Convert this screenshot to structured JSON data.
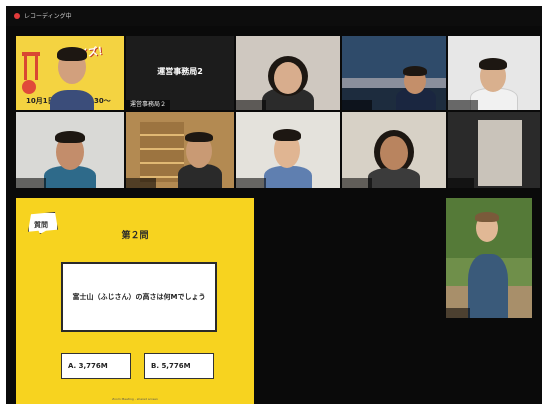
{
  "window": {
    "title": "レコーディング中"
  },
  "participants": [
    {
      "id": "p1",
      "name": ""
    },
    {
      "id": "p2",
      "name": "運営事務局2",
      "label": "運営事務局２"
    },
    {
      "id": "p3",
      "name": ""
    },
    {
      "id": "p4",
      "name": ""
    },
    {
      "id": "p5",
      "name": ""
    },
    {
      "id": "p6",
      "name": ""
    },
    {
      "id": "p7",
      "name": ""
    },
    {
      "id": "p8",
      "name": ""
    },
    {
      "id": "p9",
      "name": ""
    },
    {
      "id": "p10",
      "name": ""
    },
    {
      "id": "p11",
      "name": ""
    }
  ],
  "poster": {
    "title": "クイズ！",
    "date": "10月1日",
    "time": "30〜"
  },
  "slide": {
    "badge": "質問",
    "title": "第２問",
    "question": "富士山（ふじさん）の高さは何Mでしょう",
    "answers": [
      {
        "key": "A.",
        "value": "3,776M"
      },
      {
        "key": "B.",
        "value": "5,776M"
      }
    ],
    "footer": "Zoom Meeting - shared screen"
  },
  "colors": {
    "background": "#0a0a0a",
    "slide": "#f7d31f",
    "record": "#e23b3b"
  }
}
